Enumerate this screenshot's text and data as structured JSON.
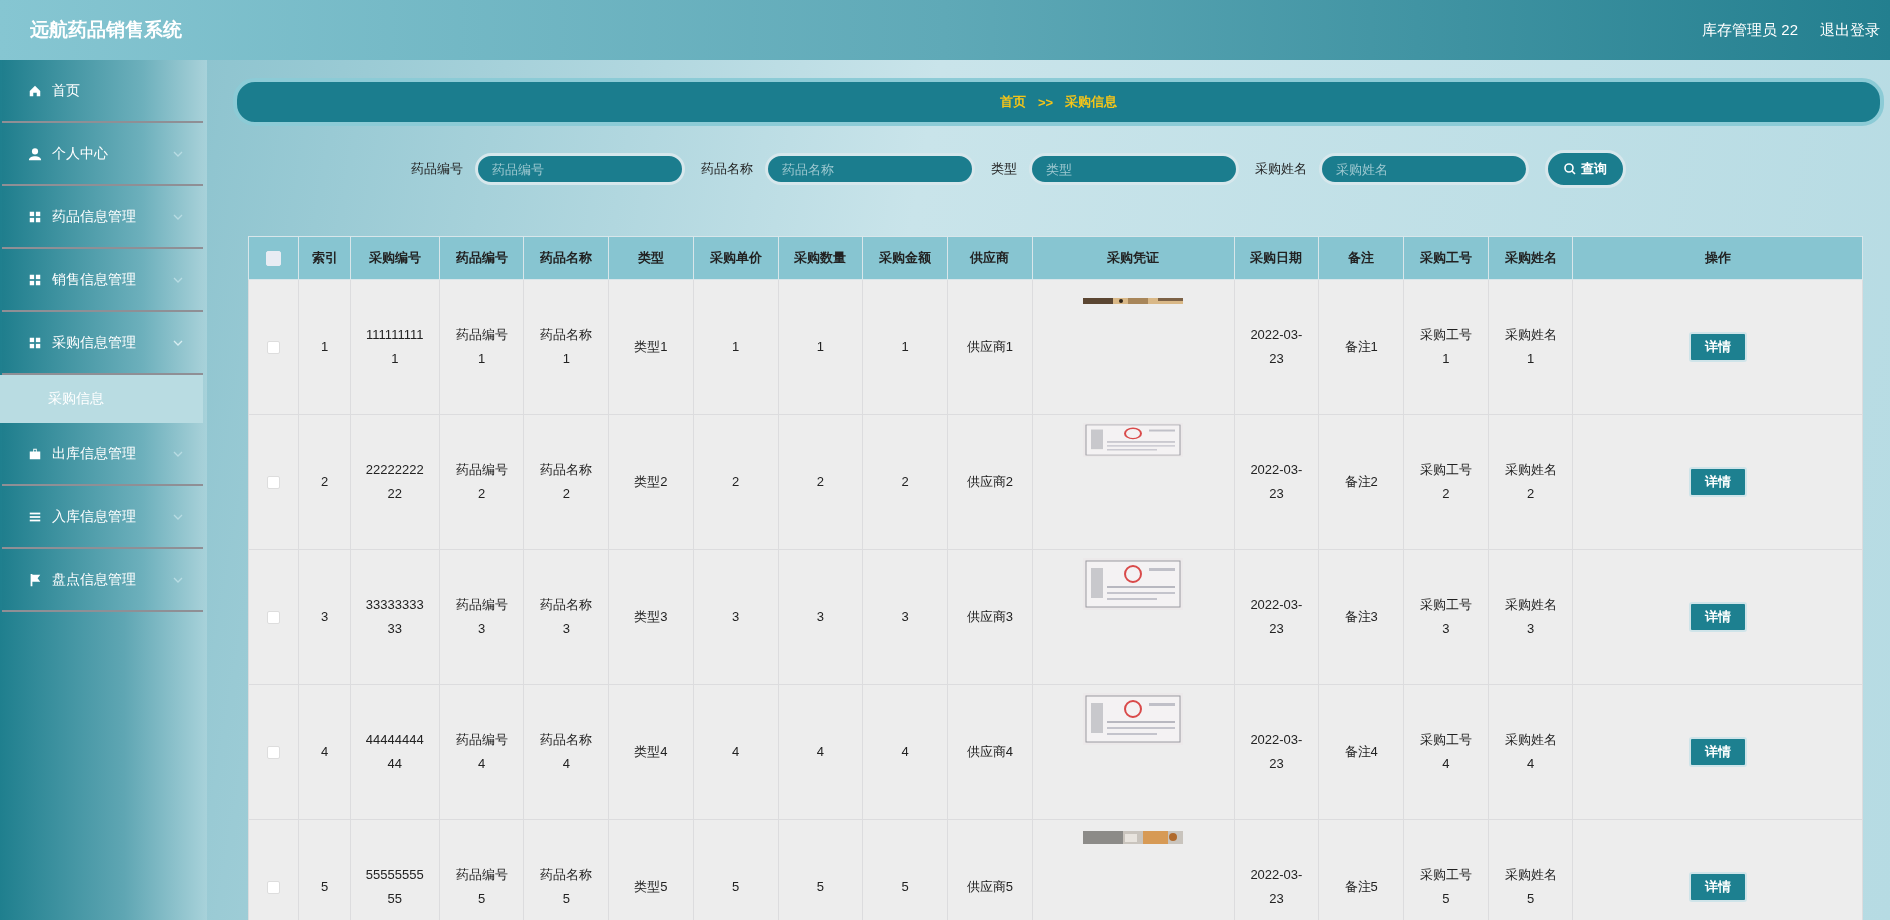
{
  "header": {
    "title": "远航药品销售系统",
    "user": "库存管理员 22",
    "logout": "退出登录"
  },
  "sidebar": {
    "items": [
      {
        "label": "首页",
        "kind": "link"
      },
      {
        "label": "个人中心",
        "kind": "menu",
        "expanded": false
      },
      {
        "label": "药品信息管理",
        "kind": "menu",
        "expanded": false
      },
      {
        "label": "销售信息管理",
        "kind": "menu",
        "expanded": false
      },
      {
        "label": "采购信息管理",
        "kind": "menu",
        "expanded": true,
        "children": [
          {
            "label": "采购信息",
            "selected": true
          }
        ]
      },
      {
        "label": "出库信息管理",
        "kind": "menu",
        "expanded": false
      },
      {
        "label": "入库信息管理",
        "kind": "menu",
        "expanded": false
      },
      {
        "label": "盘点信息管理",
        "kind": "menu",
        "expanded": false
      }
    ]
  },
  "breadcrumb": [
    "首页",
    ">>",
    "采购信息"
  ],
  "search": {
    "fields": [
      {
        "label": "药品编号",
        "placeholder": "药品编号"
      },
      {
        "label": "药品名称",
        "placeholder": "药品名称"
      },
      {
        "label": "类型",
        "placeholder": "类型"
      },
      {
        "label": "采购姓名",
        "placeholder": "采购姓名"
      }
    ],
    "button": "查询"
  },
  "table": {
    "select_all": {
      "checked": false
    },
    "columns": [
      "索引",
      "采购编号",
      "药品编号",
      "药品名称",
      "类型",
      "采购单价",
      "采购数量",
      "采购金额",
      "供应商",
      "采购凭证",
      "采购日期",
      "备注",
      "采购工号",
      "采购姓名",
      "操作"
    ],
    "rows": [
      {
        "checked": false,
        "cells": [
          "1",
          "1111111111",
          "药品编号1",
          "药品名称1",
          "类型1",
          "1",
          "1",
          "1",
          "供应商1",
          {
            "kind": "picture"
          },
          "2022-03-23",
          "备注1",
          "采购工号1",
          "采购姓名1"
        ],
        "action": "详情"
      },
      {
        "checked": false,
        "cells": [
          "2",
          "2222222222",
          "药品编号2",
          "药品名称2",
          "类型2",
          "2",
          "2",
          "2",
          "供应商2",
          {
            "kind": "picture"
          },
          "2022-03-23",
          "备注2",
          "采购工号2",
          "采购姓名2"
        ],
        "action": "详情"
      },
      {
        "checked": false,
        "cells": [
          "3",
          "3333333333",
          "药品编号3",
          "药品名称3",
          "类型3",
          "3",
          "3",
          "3",
          "供应商3",
          {
            "kind": "picture"
          },
          "2022-03-23",
          "备注3",
          "采购工号3",
          "采购姓名3"
        ],
        "action": "详情"
      },
      {
        "checked": false,
        "cells": [
          "4",
          "4444444444",
          "药品编号4",
          "药品名称4",
          "类型4",
          "4",
          "4",
          "4",
          "供应商4",
          {
            "kind": "picture"
          },
          "2022-03-23",
          "备注4",
          "采购工号4",
          "采购姓名4"
        ],
        "action": "详情"
      },
      {
        "checked": false,
        "cells": [
          "5",
          "5555555555",
          "药品编号5",
          "药品名称5",
          "类型5",
          "5",
          "5",
          "5",
          "供应商5",
          {
            "kind": "picture"
          },
          "2022-03-23",
          "备注5",
          "采购工号5",
          "采购姓名5"
        ],
        "action": "详情"
      }
    ]
  }
}
